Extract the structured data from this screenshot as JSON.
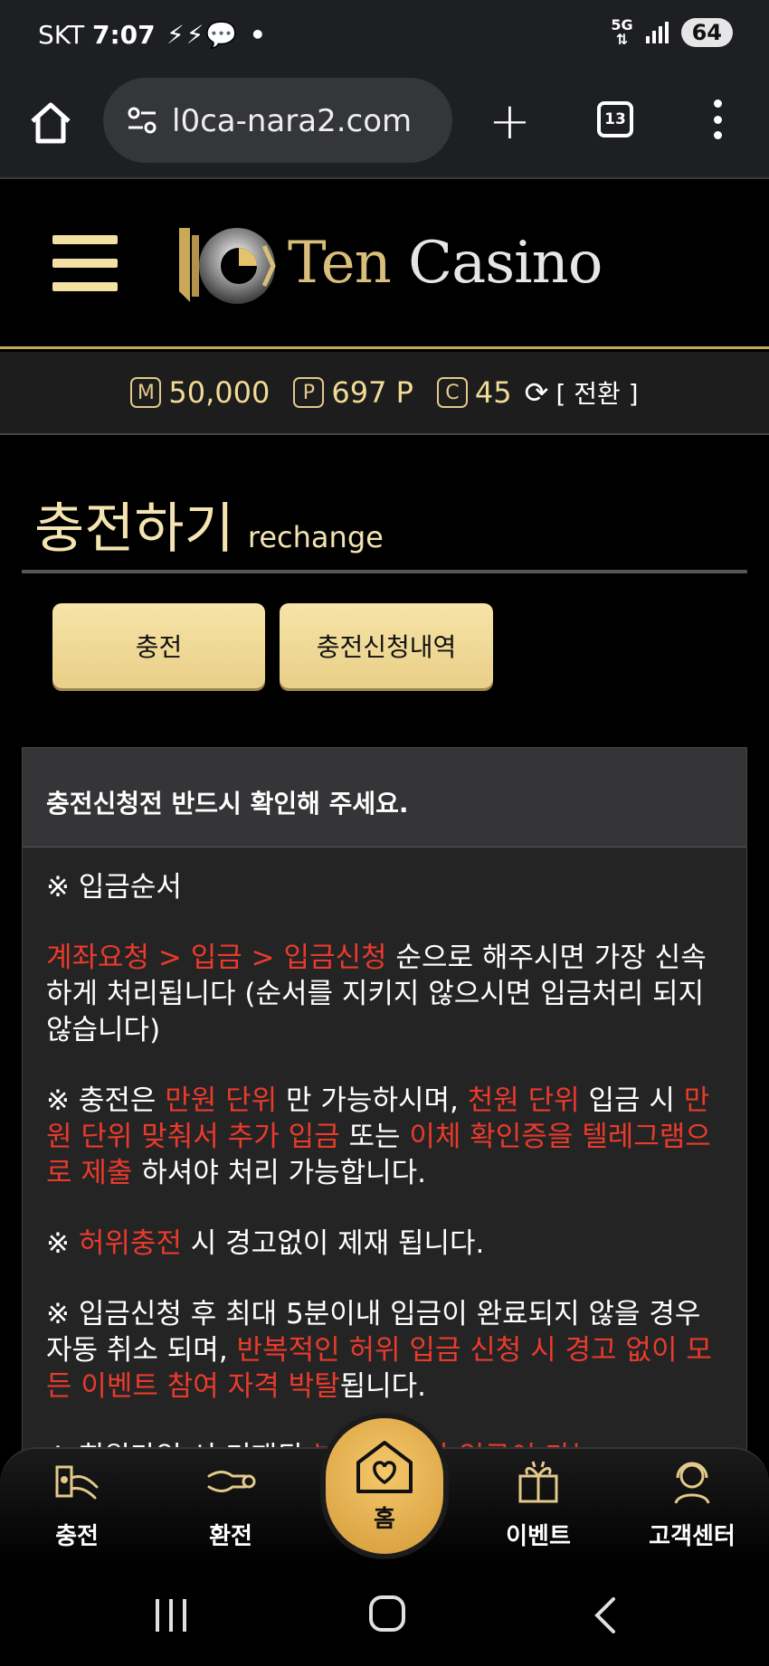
{
  "status": {
    "carrier": "SKT",
    "time": "7:07",
    "notif_icons": "⚡⚡💬 •",
    "network": "5G",
    "battery": "64"
  },
  "browser": {
    "url": "l0ca-nara2.com",
    "tab_count": "13"
  },
  "site": {
    "logo_ten": "Ten",
    "logo_casino": "Casino",
    "balance": {
      "money_icon": "M",
      "money": "50,000",
      "point_icon": "P",
      "points": "697 P",
      "coin_icon": "C",
      "coins": "45",
      "switch": "[ 전환 ]"
    }
  },
  "page": {
    "title": "충전하기",
    "subtitle": "rechange",
    "buttons": {
      "charge": "충전",
      "history": "충전신청내역"
    }
  },
  "notice": {
    "heading": "충전신청전 반드시 확인해 주세요.",
    "p1_title": "※ 입금순서",
    "p2_red": "계좌요청 > 입금 > 입금신청",
    "p2_text": " 순으로 해주시면 가장 신속하게 처리됩니다 (순서를 지키지 않으시면 입금처리 되지않습니다)",
    "p3_a": "※ 충전은 ",
    "p3_red1": "만원 단위",
    "p3_b": " 만 가능하시며, ",
    "p3_red2": "천원 단위",
    "p3_c": " 입금 시 ",
    "p3_red3": "만원 단위 맞춰서 추가 입금",
    "p3_d": " 또는 ",
    "p3_red4": "이체 확인증을 텔레그램으로 제출",
    "p3_e": " 하셔야 처리 가능합니다.",
    "p4_a": "※ ",
    "p4_red": "허위충전",
    "p4_b": " 시 경고없이 제재 됩니다.",
    "p5_a": "※ 입금신청 후 최대 5분이내 입금이 완료되지 않을 경우 자동 취소 되며, ",
    "p5_red": "반복적인 허위 입금 신청 시 경고 없이 모든 이벤트 참여 자격 박탈",
    "p5_b": "됩니다.",
    "p6_a": "※ 회원가입 시 기재된 ",
    "p6_red": "본인 계좌만 입금이 가능"
  },
  "bottom_nav": {
    "charge": "충전",
    "exchange": "환전",
    "home": "홈",
    "event": "이벤트",
    "support": "고객센터"
  },
  "colors": {
    "gold": "#e9cf88",
    "red": "#ea3a2c",
    "bg": "#000000"
  }
}
